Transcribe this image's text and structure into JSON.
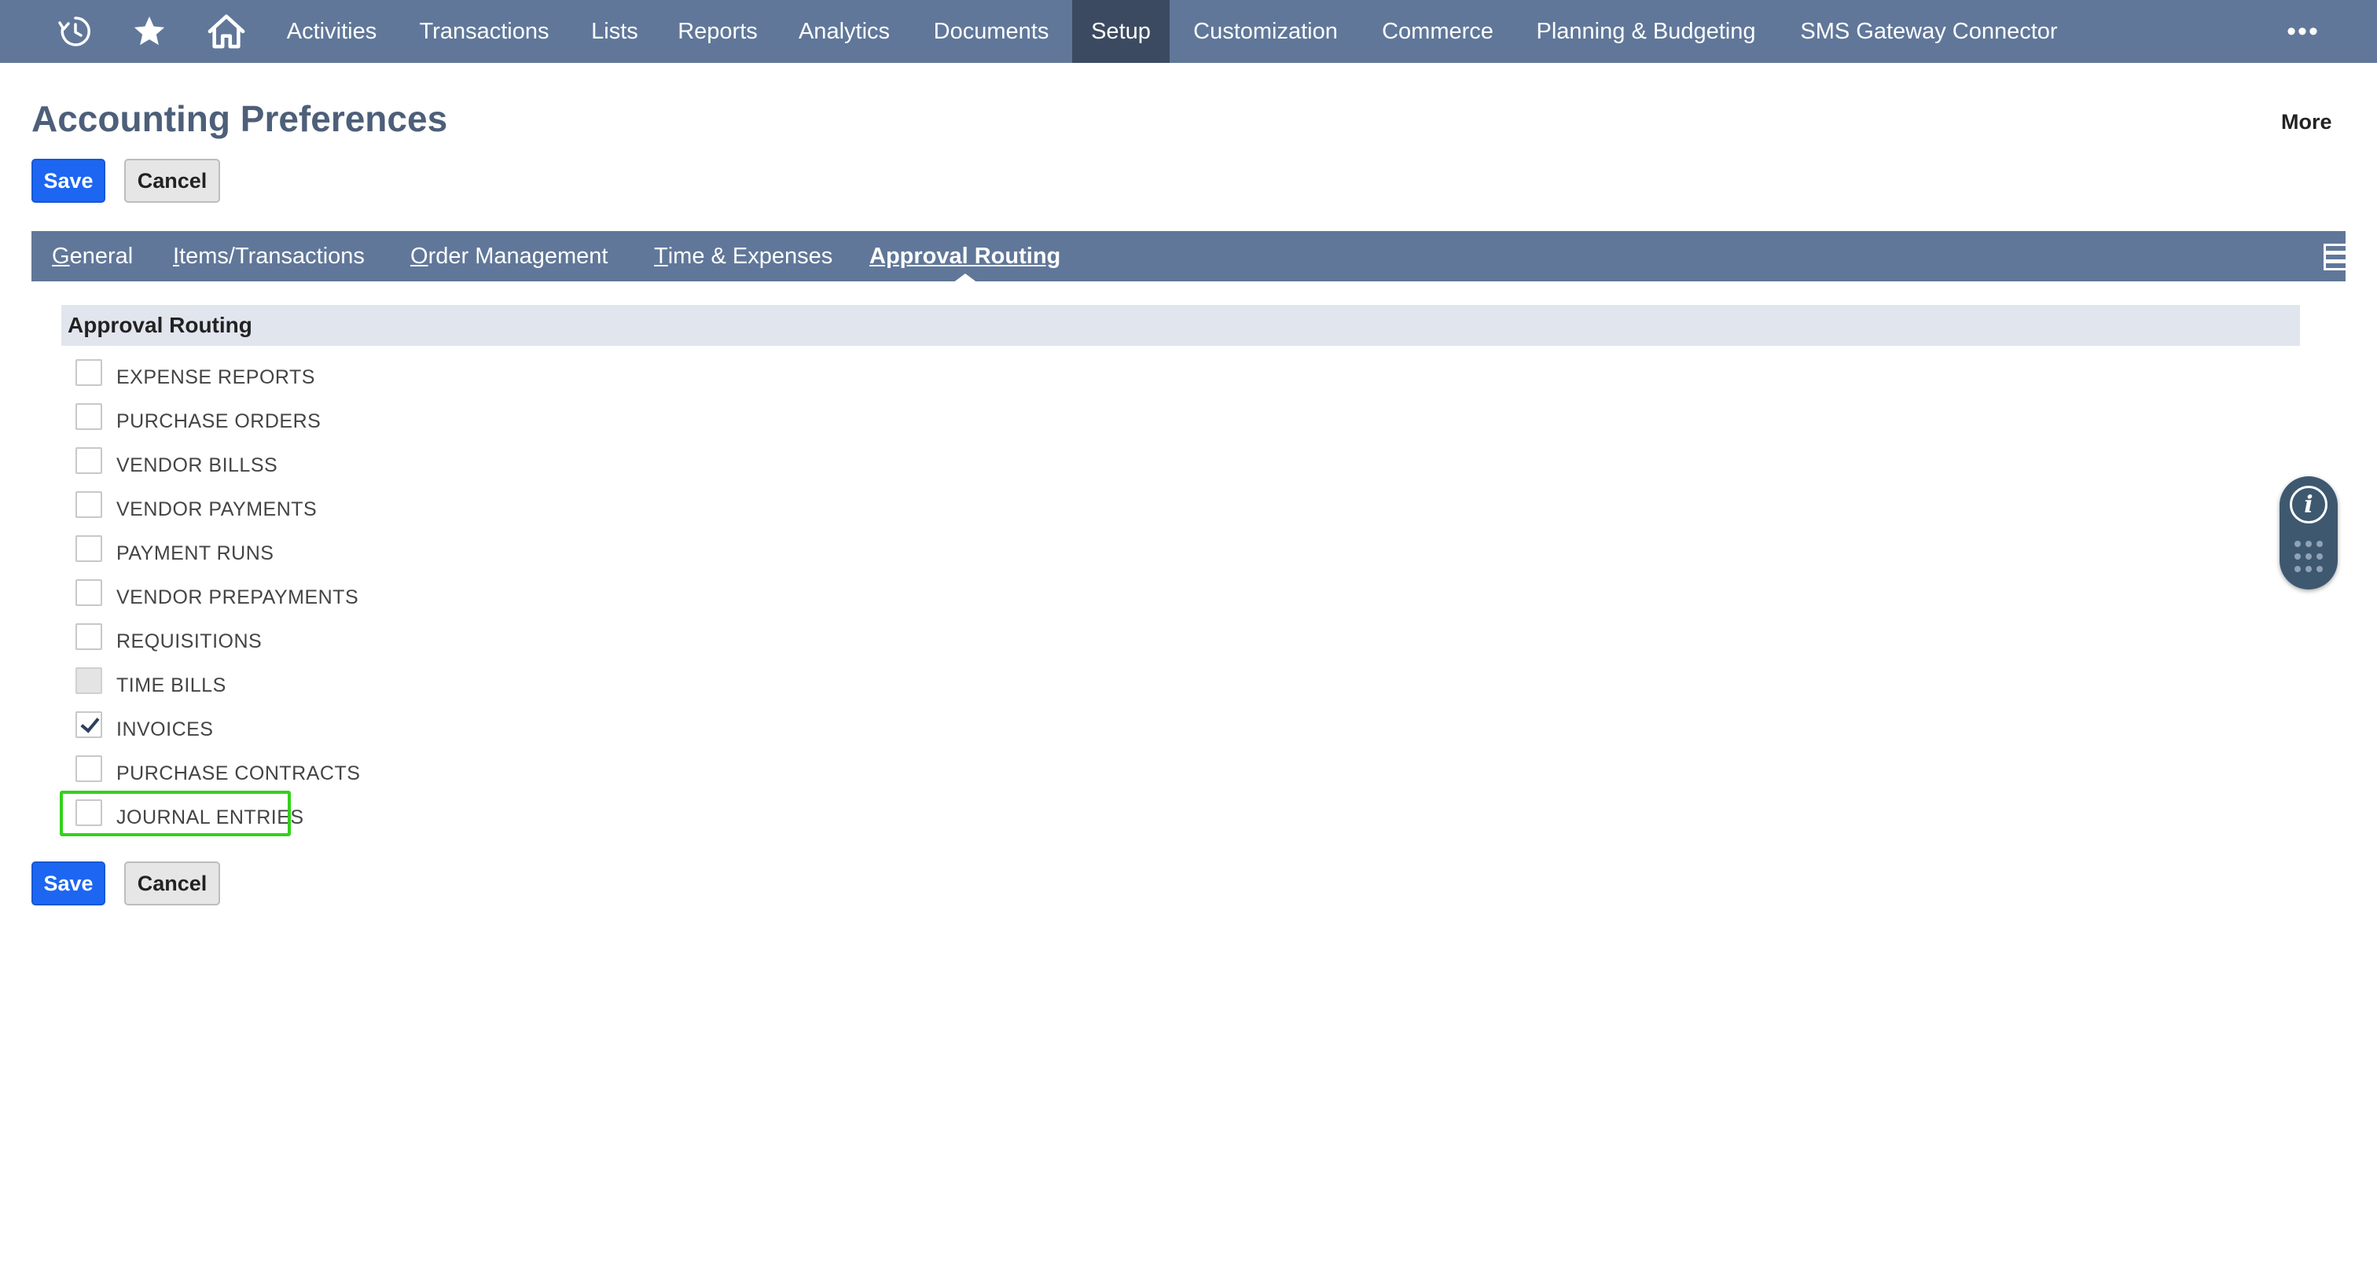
{
  "topnav": {
    "icons": [
      "recent-icon",
      "star-icon",
      "home-icon"
    ],
    "items": [
      {
        "label": "Activities"
      },
      {
        "label": "Transactions"
      },
      {
        "label": "Lists"
      },
      {
        "label": "Reports"
      },
      {
        "label": "Analytics"
      },
      {
        "label": "Documents"
      },
      {
        "label": "Setup",
        "active": true
      },
      {
        "label": "Customization"
      },
      {
        "label": "Commerce"
      },
      {
        "label": "Planning & Budgeting"
      },
      {
        "label": "SMS Gateway Connector"
      }
    ],
    "more_label": "•••"
  },
  "header": {
    "title": "Accounting Preferences",
    "more_label": "More"
  },
  "buttons": {
    "save_label": "Save",
    "cancel_label": "Cancel"
  },
  "subtabs": {
    "items": [
      {
        "accel": "G",
        "rest": "eneral"
      },
      {
        "accel": "I",
        "rest": "tems/Transactions"
      },
      {
        "accel": "O",
        "rest": "rder Management"
      },
      {
        "accel": "T",
        "rest": "ime & Expenses"
      },
      {
        "accel": "",
        "rest": "Approval Routing",
        "active": true
      }
    ]
  },
  "section": {
    "title": "Approval Routing",
    "checkboxes": [
      {
        "label": "EXPENSE REPORTS",
        "checked": false,
        "disabled": false
      },
      {
        "label": "PURCHASE ORDERS",
        "checked": false,
        "disabled": false
      },
      {
        "label": "VENDOR BILLSS",
        "checked": false,
        "disabled": false
      },
      {
        "label": "VENDOR PAYMENTS",
        "checked": false,
        "disabled": false
      },
      {
        "label": "PAYMENT RUNS",
        "checked": false,
        "disabled": false
      },
      {
        "label": "VENDOR PREPAYMENTS",
        "checked": false,
        "disabled": false
      },
      {
        "label": "REQUISITIONS",
        "checked": false,
        "disabled": false
      },
      {
        "label": "TIME BILLS",
        "checked": false,
        "disabled": true
      },
      {
        "label": "INVOICES",
        "checked": true,
        "disabled": false
      },
      {
        "label": "PURCHASE CONTRACTS",
        "checked": false,
        "disabled": false
      },
      {
        "label": "JOURNAL ENTRIES",
        "checked": false,
        "disabled": false,
        "highlighted": true
      }
    ]
  },
  "float_widget": {
    "info_glyph": "i"
  },
  "colors": {
    "nav_bg": "#607799",
    "nav_active": "#3b4a60",
    "save_blue": "#1c66f2",
    "highlight_green": "#33d11a",
    "section_bg": "#e1e5ed"
  }
}
